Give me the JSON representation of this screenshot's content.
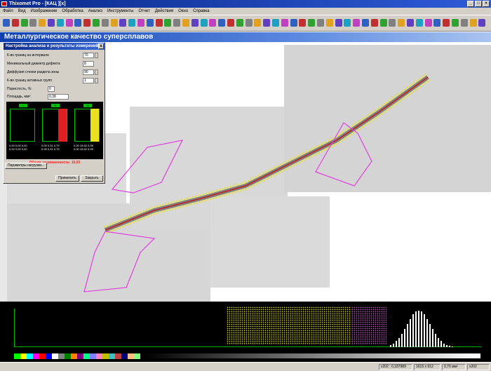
{
  "window": {
    "title": "Thixomet Pro - [КАЦ ][x]"
  },
  "menu": [
    "Файл",
    "Вид",
    "Изображение",
    "Обработка",
    "Анализ",
    "Инструменты",
    "Отчет",
    "Действия",
    "Окно",
    "Справка"
  ],
  "banner": {
    "title": "Металлургическое качество суперсплавов"
  },
  "dialog": {
    "title": "Настройка анализа и результаты измерений",
    "close_label": "x",
    "fields": [
      {
        "label": "К-во границ на интервале",
        "value": "70"
      },
      {
        "label": "Минимальный диаметр дефекта",
        "value": "8"
      },
      {
        "label": "Диффузия стенки раздела зоны",
        "value": "90"
      },
      {
        "label": "К-во границ активных групп",
        "value": "1"
      },
      {
        "label": "Пористость, %:",
        "value": "0"
      },
      {
        "label": "Площадь, мм²:",
        "value": "0,38"
      }
    ],
    "panels": [
      {
        "head": "I",
        "color": "#000000",
        "vals": [
          "0,00  0,00  0,00",
          "0,00  0,00  0,00"
        ]
      },
      {
        "head": "II",
        "color": "#e02020",
        "vals": [
          "0,00  0,31  0,79",
          "0,00  0,31  0,79"
        ]
      },
      {
        "head": "III",
        "color": "#e8e020",
        "vals": [
          "0,00  15,62  0,95",
          "0,00  15,62  0,95"
        ]
      }
    ],
    "overall": "Общая загрязненность: 16,93",
    "extra_button": "Параметры нагрузки...",
    "apply_button": "Применить",
    "close_button": "Закрыть"
  },
  "status": [
    "x202 : 0,187989",
    "1615 x 912",
    "0,76 мм²",
    "x202"
  ],
  "colors": {
    "accent": "#1040b0",
    "yellow": "#e8e020",
    "pink": "#e040e0",
    "green": "#00b000"
  }
}
